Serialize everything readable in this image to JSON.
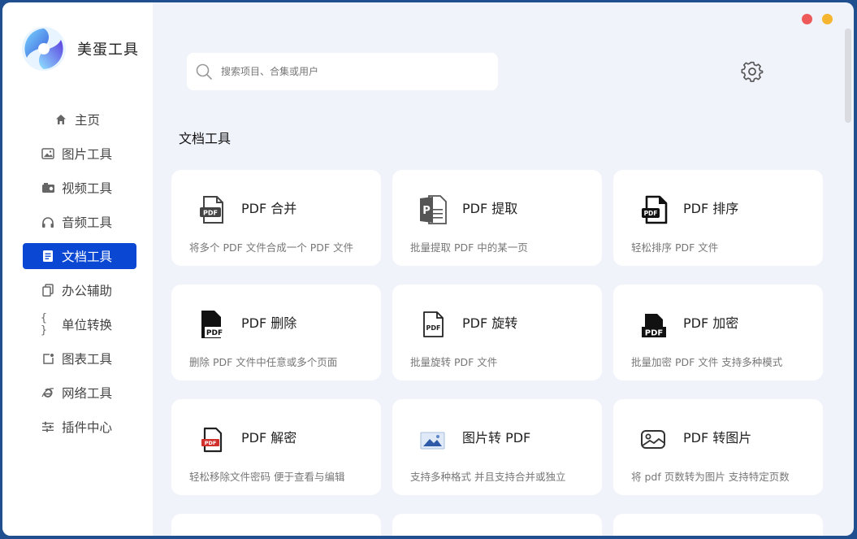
{
  "app": {
    "name": "美蛋工具"
  },
  "search": {
    "placeholder": "搜索项目、合集或用户"
  },
  "sidebar": {
    "items": [
      {
        "label": "主页",
        "icon": "home-icon",
        "active": false
      },
      {
        "label": "图片工具",
        "icon": "image-icon",
        "active": false
      },
      {
        "label": "视频工具",
        "icon": "video-icon",
        "active": false
      },
      {
        "label": "音频工具",
        "icon": "headphones-icon",
        "active": false
      },
      {
        "label": "文档工具",
        "icon": "document-icon",
        "active": true
      },
      {
        "label": "办公辅助",
        "icon": "copy-icon",
        "active": false
      },
      {
        "label": "单位转换",
        "icon": "braces-icon",
        "active": false
      },
      {
        "label": "图表工具",
        "icon": "chart-icon",
        "active": false
      },
      {
        "label": "网络工具",
        "icon": "browser-icon",
        "active": false
      },
      {
        "label": "插件中心",
        "icon": "sliders-icon",
        "active": false
      }
    ]
  },
  "main": {
    "section_title": "文档工具",
    "cards": [
      {
        "title": "PDF 合并",
        "desc": "将多个 PDF 文件合成一个 PDF 文件",
        "icon": "pdf-merge-icon"
      },
      {
        "title": "PDF 提取",
        "desc": "批量提取 PDF 中的某一页",
        "icon": "pdf-extract-icon"
      },
      {
        "title": "PDF 排序",
        "desc": "轻松排序 PDF 文件",
        "icon": "pdf-sort-icon"
      },
      {
        "title": "PDF 删除",
        "desc": "删除 PDF 文件中任意或多个页面",
        "icon": "pdf-delete-icon"
      },
      {
        "title": "PDF 旋转",
        "desc": "批量旋转 PDF 文件",
        "icon": "pdf-rotate-icon"
      },
      {
        "title": "PDF 加密",
        "desc": "批量加密 PDF 文件 支持多种模式",
        "icon": "pdf-encrypt-icon"
      },
      {
        "title": "PDF 解密",
        "desc": "轻松移除文件密码 便于查看与编辑",
        "icon": "pdf-decrypt-icon"
      },
      {
        "title": "图片转 PDF",
        "desc": "支持多种格式 并且支持合并或独立",
        "icon": "image-to-pdf-icon"
      },
      {
        "title": "PDF 转图片",
        "desc": "将 pdf 页数转为图片 支持特定页数",
        "icon": "pdf-to-image-icon"
      }
    ]
  },
  "colors": {
    "accent": "#0a48d4",
    "close_dot": "#ee5a5a",
    "minimize_dot": "#f5b52e",
    "background": "#f1f3fb"
  }
}
